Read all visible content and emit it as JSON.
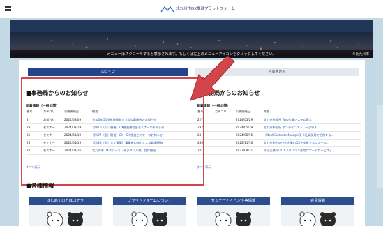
{
  "header": {
    "menu_icon": "hamburger-icon",
    "logo_icon": "logo-mark",
    "site_title": "北九州市DX推進プラットフォーム"
  },
  "hero": {
    "notice": "メニューはスクロールすると表示されます。もしくは左上のメニューアイコンをクリックしてください。",
    "credit": "©北九州市"
  },
  "tabs": {
    "login": "ログイン",
    "apply": "入会申込み"
  },
  "news_left": {
    "title": "■事務局からのお知らせ",
    "subtitle": "新着情報（一般公開）",
    "columns": [
      "番号",
      "カテゴリ",
      "公開開始日",
      "概要"
    ],
    "rows": [
      [
        "2",
        "お知らせ",
        "2024/09/09",
        "令和6年度DX推進補助金 2次公募開始のお知らせ"
      ],
      [
        "23",
        "セミナー",
        "2024/08/19",
        "【9/10（火）開催】DX推進補助金セミナーのお知らせ"
      ],
      [
        "25",
        "セミナー",
        "2024/08/19",
        "【9/27（金）開催】GX・DX推進セミナーのお知らせ"
      ],
      [
        "26",
        "セミナー",
        "2024/08/19",
        "【9/13（金）まで募集】事業者の協力による職員研修"
      ],
      [
        "27",
        "セミナー",
        "2024/08/16",
        "北九州市 DXスクール（デジタル人材）受付開始"
      ]
    ],
    "more": "すべて表示"
  },
  "news_right": {
    "title": "■事務局からのお知らせ",
    "subtitle": "新着情報（一般公開）",
    "columns": [
      "番号",
      "カテゴリ",
      "公開開始日",
      "概要"
    ],
    "rows": [
      [
        "227",
        "",
        "2024/05/29",
        "北九州市役所 Web会議システム導入"
      ],
      [
        "237",
        "",
        "2024/05/29",
        "北九州市役所 オンラインストレージ導入"
      ],
      [
        "23",
        "",
        "2024/05/16",
        "【NextContentsManager】※社員採用で活用する..."
      ],
      [
        "446",
        "",
        "2022/11/16",
        "北九州市内の中小企業のDXを支援するシステム..."
      ],
      [
        "741",
        "",
        "2022/08/31",
        "中小企業向けDX「パソコン活用サポートサービス」"
      ]
    ],
    "more": "すべて表示"
  },
  "info": {
    "title": "■各種情報",
    "cards": [
      {
        "label": "はじめての方はコチラ"
      },
      {
        "label": "プラットフォームについて"
      },
      {
        "label": "セミナー・イベント等情報"
      },
      {
        "label": "会員情報"
      }
    ]
  },
  "colors": {
    "nav_blue": "#23458a",
    "card_blue": "#2c4d8e",
    "highlight_red": "#d2454a",
    "link_blue": "#2a5db0"
  }
}
